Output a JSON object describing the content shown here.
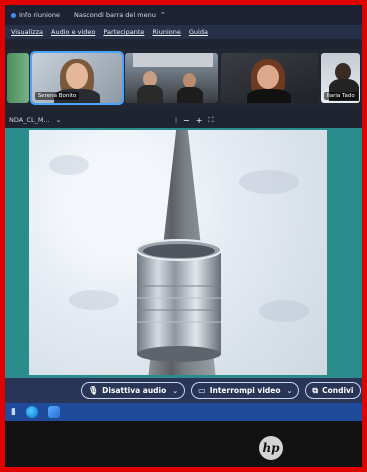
{
  "topbar": {
    "meeting_info": "Info riunione",
    "hide_menu": "Nascondi barra del menu"
  },
  "menubar": {
    "items": [
      "Visualizza",
      "Audio e video",
      "Partecipante",
      "Riunione",
      "Guida"
    ]
  },
  "participants": [
    {
      "name": ""
    },
    {
      "name": "Serena Bonito"
    },
    {
      "name": ""
    },
    {
      "name": ""
    },
    {
      "name": "Ilaria Tado"
    }
  ],
  "share": {
    "title": "NDA_CL_M...",
    "zoom_out": "−",
    "zoom_in": "+"
  },
  "controls": {
    "mute_audio": "Disattiva audio",
    "stop_video": "Interrompi video",
    "share": "Condivi"
  },
  "branding": {
    "laptop_logo": "hp"
  },
  "colors": {
    "accent_blue": "#4aa3ff",
    "controls_bg": "#283556",
    "frame_red": "#e00000"
  }
}
